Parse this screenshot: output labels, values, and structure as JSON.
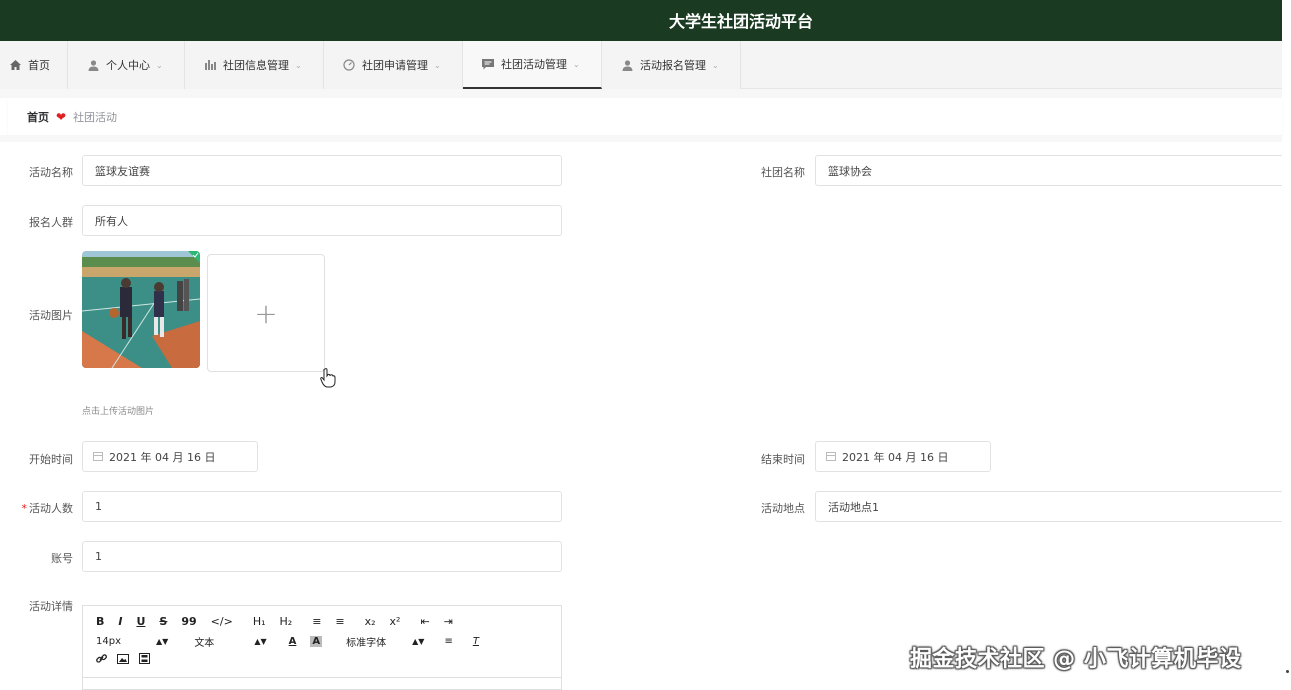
{
  "app": {
    "title": "大学生社团活动平台"
  },
  "nav": {
    "items": [
      {
        "label": "首页",
        "icon": "home-icon",
        "dropdown": false
      },
      {
        "label": "个人中心",
        "icon": "user-icon",
        "dropdown": true
      },
      {
        "label": "社团信息管理",
        "icon": "chart-icon",
        "dropdown": true
      },
      {
        "label": "社团申请管理",
        "icon": "dashboard-icon",
        "dropdown": true
      },
      {
        "label": "社团活动管理",
        "icon": "chat-icon",
        "dropdown": true,
        "active": true
      },
      {
        "label": "活动报名管理",
        "icon": "user-icon",
        "dropdown": true
      }
    ]
  },
  "breadcrumb": {
    "home": "首页",
    "current": "社团活动"
  },
  "form": {
    "activity_name": {
      "label": "活动名称",
      "value": "篮球友谊赛"
    },
    "club_name": {
      "label": "社团名称",
      "value": "篮球协会"
    },
    "audience": {
      "label": "报名人群",
      "value": "所有人"
    },
    "image": {
      "label": "活动图片",
      "upload_plus": "+",
      "hint": "点击上传活动图片"
    },
    "start_time": {
      "label": "开始时间",
      "value": "2021 年 04 月 16 日"
    },
    "end_time": {
      "label": "结束时间",
      "value": "2021 年 04 月 16 日"
    },
    "participants": {
      "label": "活动人数",
      "required_mark": "*",
      "value": "1"
    },
    "location": {
      "label": "活动地点",
      "value": "活动地点1"
    },
    "account": {
      "label": "账号",
      "value": "1"
    },
    "details": {
      "label": "活动详情",
      "toolbar_row1": [
        "B",
        "I",
        "U",
        "S",
        "99",
        "</>",
        "H₁",
        "H₂",
        "≡",
        "≡",
        "x₂",
        "x²",
        "⇤",
        "⇥"
      ],
      "font_size": "14px",
      "text_style": "文本",
      "font_family": "标准字体"
    }
  },
  "watermark": "掘金技术社区 @ 小飞计算机毕设",
  "colors": {
    "topbar": "#1b3a22",
    "required": "#e02020"
  }
}
